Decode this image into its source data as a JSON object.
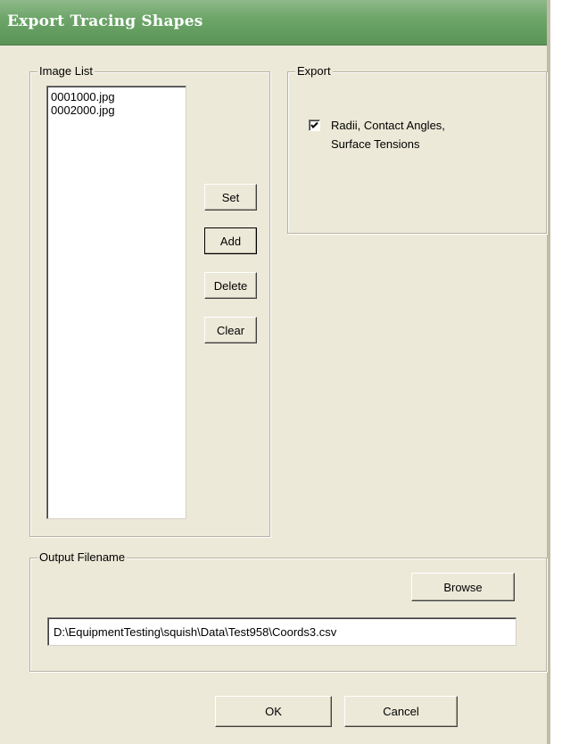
{
  "window": {
    "title": "Export Tracing Shapes"
  },
  "image_list": {
    "legend": "Image List",
    "items": [
      "0001000.jpg",
      "0002000.jpg"
    ],
    "buttons": {
      "set": "Set",
      "add": "Add",
      "delete": "Delete",
      "clear": "Clear"
    }
  },
  "export": {
    "legend": "Export",
    "checkbox_checked": true,
    "checkbox_label_line1": "Radii, Contact Angles,",
    "checkbox_label_line2": "Surface Tensions"
  },
  "output": {
    "legend": "Output Filename",
    "browse_label": "Browse",
    "filename": "D:\\EquipmentTesting\\squish\\Data\\Test958\\Coords3.csv"
  },
  "footer": {
    "ok_label": "OK",
    "cancel_label": "Cancel"
  },
  "colors": {
    "titlebar": "#6ea66a",
    "dialog_bg": "#ece9d8"
  }
}
